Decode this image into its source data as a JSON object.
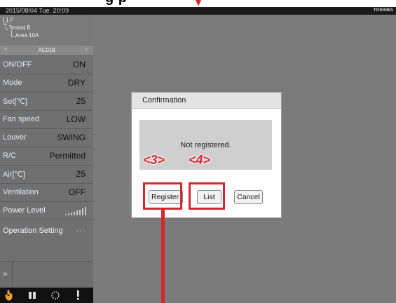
{
  "caption": {
    "partial_text": "g               p"
  },
  "titlebar": {
    "datetime": "2015/08/04  Tue.  20:09",
    "brand": "TOSHIBA"
  },
  "tree": {
    "floor": "1 F",
    "tenant": "Tenant B",
    "area": "Area 10A"
  },
  "unit_nav": {
    "prev": "<",
    "name": "AC018",
    "next": ">"
  },
  "sidebar": {
    "rows": [
      {
        "label": "ON/OFF",
        "value": "ON"
      },
      {
        "label": "Mode",
        "value": "DRY"
      },
      {
        "label": "Set[℃]",
        "value": "25"
      },
      {
        "label": "Fan speed",
        "value": "LOW"
      },
      {
        "label": "Louver",
        "value": "SWING"
      },
      {
        "label": "R/C",
        "value": "Permitted"
      },
      {
        "label": "Air[℃]",
        "value": "25"
      },
      {
        "label": "Ventilation",
        "value": "OFF"
      },
      {
        "label": "Power Level",
        "value": ""
      },
      {
        "label": "Operation Setting",
        "value": ""
      }
    ],
    "power_level_bars": 8,
    "operation_dots": "···",
    "expand_chevron": "»"
  },
  "toolbar": {
    "icons": [
      "hand-icon",
      "book-icon",
      "settings-ring-icon",
      "alert-icon"
    ]
  },
  "dialog": {
    "title": "Confirmation",
    "message": "Not registered.",
    "buttons": {
      "register": "Register",
      "list": "List",
      "cancel": "Cancel"
    }
  },
  "callouts": {
    "register": "<3>",
    "list": "<4>"
  },
  "colors": {
    "accent_red": "#d6252c",
    "sidebar_bg": "#707070",
    "main_bg": "#7b7b7b"
  }
}
